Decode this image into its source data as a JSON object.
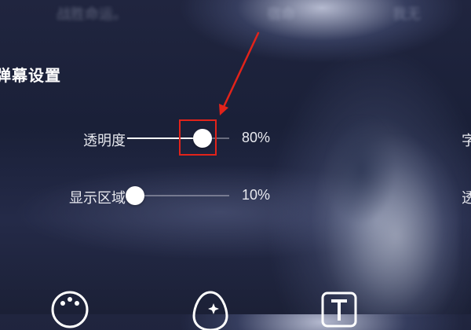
{
  "background_text": [
    "战胜命运。",
    "宿命",
    "我无"
  ],
  "panel": {
    "title": "弹幕设置",
    "rows": [
      {
        "label": "透明度",
        "value_text": "80%",
        "level": 0.74,
        "right_edge_label": "字"
      },
      {
        "label": "显示区域",
        "value_text": "10%",
        "level": 0.08,
        "right_edge_label": "透"
      }
    ]
  },
  "bottom_icons": [
    "palette-icon",
    "magic-egg-icon",
    "text-style-icon"
  ],
  "annotation": {
    "color": "#e2231a"
  }
}
